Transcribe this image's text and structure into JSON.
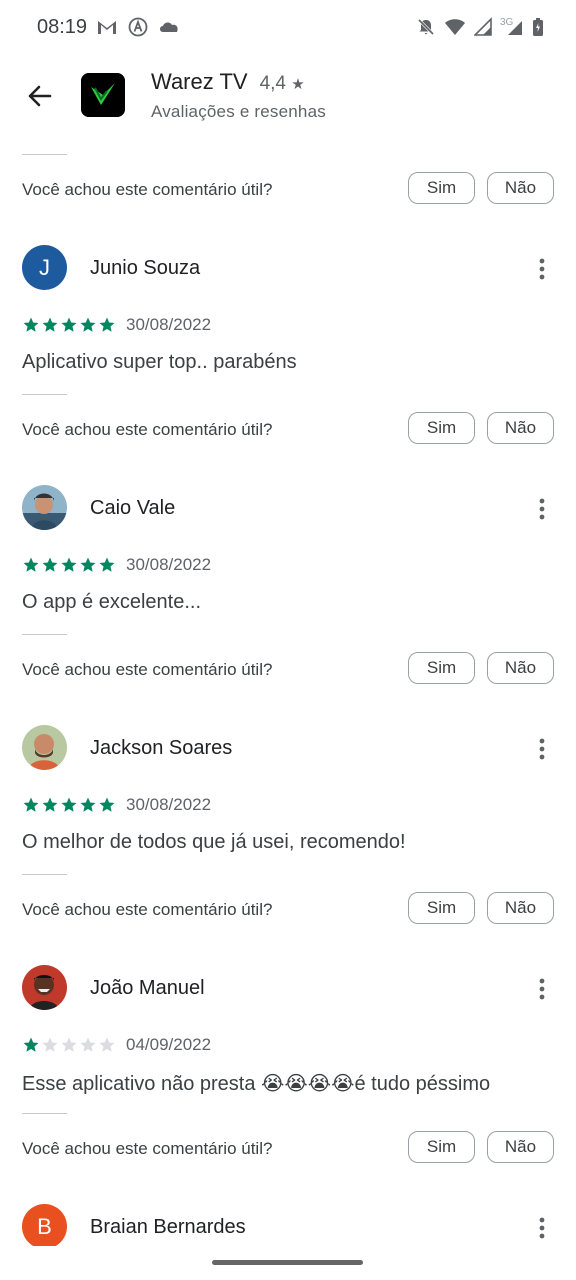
{
  "status_bar": {
    "time": "08:19",
    "left_icons": [
      "gmail-icon",
      "auto-a-icon",
      "cloud-icon"
    ],
    "right_icons": [
      "muted-bell-icon",
      "wifi-icon",
      "signal-icon",
      "3g-signal-icon",
      "battery-icon"
    ],
    "network_label": "3G"
  },
  "header": {
    "app_name": "Warez TV",
    "rating": "4,4",
    "subtitle": "Avaliações e resenhas",
    "colors": {
      "icon_bg": "#000000",
      "icon_accent": "#2ecc40"
    }
  },
  "helpful": {
    "question": "Você achou este comentário útil?",
    "yes": "Sim",
    "no": "Não"
  },
  "reviews": [
    {
      "name": "Junio Souza",
      "avatar_letter": "J",
      "avatar_color": "#1e5a9e",
      "stars": 5,
      "date": "30/08/2022",
      "text": "Aplicativo super top.. parabéns"
    },
    {
      "name": "Caio Vale",
      "avatar_letter": "",
      "avatar_color": "#6c8fa6",
      "stars": 5,
      "date": "30/08/2022",
      "text": "O app é excelente..."
    },
    {
      "name": "Jackson Soares",
      "avatar_letter": "",
      "avatar_color": "#b5806a",
      "stars": 5,
      "date": "30/08/2022",
      "text": "O melhor de todos que já usei, recomendo!"
    },
    {
      "name": "João Manuel",
      "avatar_letter": "",
      "avatar_color": "#a8342b",
      "stars": 1,
      "date": "04/09/2022",
      "text": "Esse aplicativo não presta 😭😭😭😭é tudo péssimo"
    },
    {
      "name": "Braian Bernardes",
      "avatar_letter": "B",
      "avatar_color": "#e8501f"
    }
  ],
  "colors": {
    "star_filled": "#01875f",
    "star_empty": "#dadce0"
  }
}
